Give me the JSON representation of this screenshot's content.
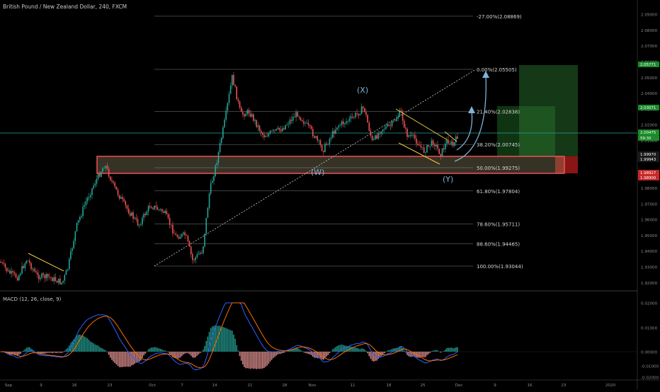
{
  "header": {
    "symbol_title": "British Pound / New Zealand Dollar, 240, FXCM"
  },
  "indicator": {
    "macd_title": "MACD (12, 26, close, 9)"
  },
  "colors": {
    "up": "#26a69a",
    "down": "#ef5350",
    "fib": "#b2b5be",
    "trend": "#f5c542",
    "zone_fill": "#9a8f6a",
    "zone_border": "#ef5350",
    "tp_zone": "#2e7d32",
    "sl_zone": "#b71c1c",
    "hline": "#26a69a",
    "arrow": "#7fb2d9",
    "axis_text": "#8a8a8a"
  },
  "fib_levels": [
    {
      "label": "-27.00%(2.08869)",
      "value": 2.08869
    },
    {
      "label": "0.00%(2.05505)",
      "value": 2.05505
    },
    {
      "label": "21.40%(2.02838)",
      "value": 2.02838
    },
    {
      "label": "38.20%(2.00745)",
      "value": 2.00745
    },
    {
      "label": "50.00%(1.99275)",
      "value": 1.99275
    },
    {
      "label": "61.80%(1.97804)",
      "value": 1.97804
    },
    {
      "label": "78.60%(1.95711)",
      "value": 1.95711
    },
    {
      "label": "88.60%(1.94465)",
      "value": 1.94465
    },
    {
      "label": "100.00%(1.93044)",
      "value": 1.93044
    }
  ],
  "wave_labels": {
    "x": "(X)",
    "w": "(W)",
    "y": "(Y)"
  },
  "price_axis": {
    "ticks": [
      "2.09000",
      "2.08000",
      "2.07000",
      "2.06000",
      "2.05000",
      "2.04000",
      "2.03000",
      "2.02000",
      "2.01000",
      "2.00000",
      "1.99000",
      "1.98000",
      "1.97000",
      "1.96000",
      "1.95000",
      "1.94000",
      "1.93000",
      "1.92000"
    ],
    "badges": [
      {
        "text": "2.05771",
        "kind": "green"
      },
      {
        "text": "2.03071",
        "kind": "green"
      },
      {
        "text": "2.00475",
        "kind": "green"
      },
      {
        "text": "59:30",
        "kind": "green"
      },
      {
        "text": "1.99970",
        "kind": "dark"
      },
      {
        "text": "1.99943",
        "kind": "dark"
      },
      {
        "text": "1.98927",
        "kind": "red"
      },
      {
        "text": "1.98900",
        "kind": "red"
      }
    ]
  },
  "macd_axis": {
    "ticks": [
      "0.02000",
      "0.01000",
      "0.00000",
      "-0.01000",
      "-0.02000"
    ]
  },
  "time_axis": {
    "ticks": [
      "Sep",
      "9",
      "16",
      "23",
      "Oct",
      "7",
      "14",
      "21",
      "28",
      "Nov",
      "11",
      "18",
      "25",
      "Dec",
      "9",
      "16",
      "23",
      "2020"
    ]
  }
}
